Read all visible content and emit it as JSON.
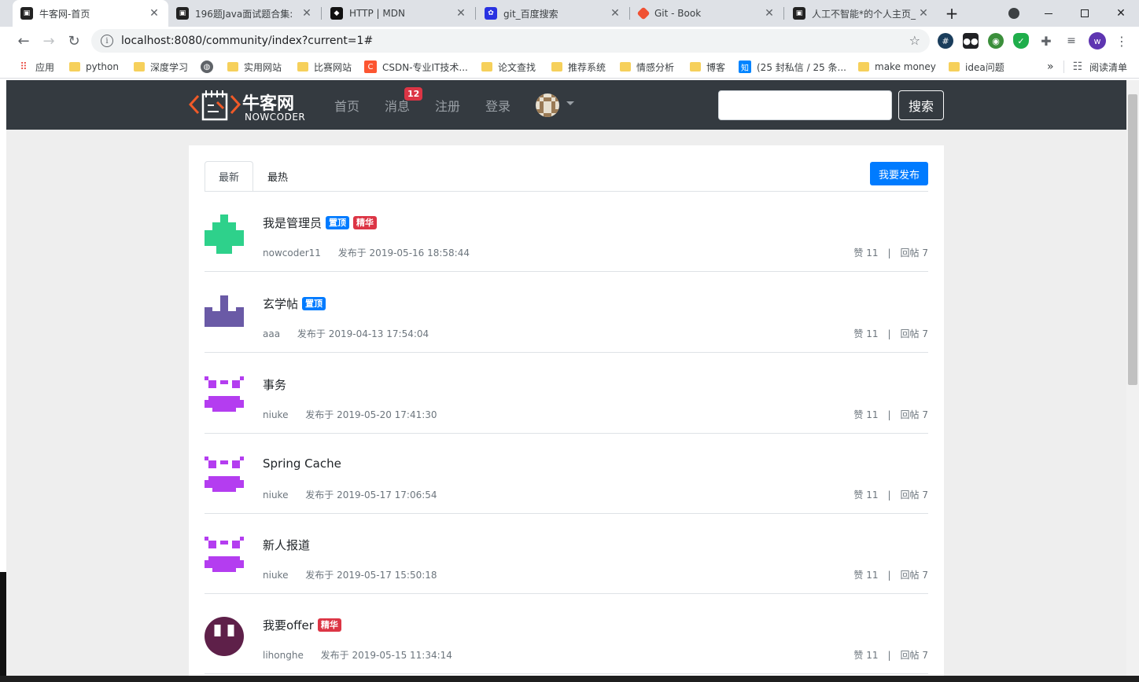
{
  "browser": {
    "tabs": [
      {
        "title": "牛客网-首页",
        "active": true
      },
      {
        "title": "196题Java面试题合集: ",
        "active": false
      },
      {
        "title": "HTTP | MDN",
        "active": false
      },
      {
        "title": "git_百度搜索",
        "active": false
      },
      {
        "title": "Git - Book",
        "active": false
      },
      {
        "title": "人工不智能*的个人主页_",
        "active": false
      }
    ],
    "new_tab": "+",
    "close_glyph": "✕",
    "url": "localhost:8080/community/index?current=1#",
    "profile_initial": "w",
    "bookmarks": [
      {
        "label": "应用",
        "icon": "apps-icon"
      },
      {
        "label": "python",
        "icon": "folder-icon"
      },
      {
        "label": "深度学习",
        "icon": "folder-icon"
      },
      {
        "label": "",
        "icon": "globe-icon"
      },
      {
        "label": "实用网站",
        "icon": "folder-icon"
      },
      {
        "label": "比赛网站",
        "icon": "folder-icon"
      },
      {
        "label": "CSDN-专业IT技术...",
        "icon": "csdn-icon"
      },
      {
        "label": "论文查找",
        "icon": "folder-icon"
      },
      {
        "label": "推荐系统",
        "icon": "folder-icon"
      },
      {
        "label": "情感分析",
        "icon": "folder-icon"
      },
      {
        "label": "博客",
        "icon": "folder-icon"
      },
      {
        "label": "(25 封私信 / 25 条...",
        "icon": "zhihu-icon"
      },
      {
        "label": "make money",
        "icon": "folder-icon"
      },
      {
        "label": "idea问题",
        "icon": "folder-icon"
      }
    ],
    "more_bookmarks": "»",
    "reading_list": "阅读清单",
    "colors": {
      "tab_strip": "#dee1e6",
      "folder": "#f6d05b"
    }
  },
  "site": {
    "brand": "牛客网",
    "brand_sub": "NOWCODER",
    "nav": {
      "home": "首页",
      "messages": "消息",
      "register": "注册",
      "login": "登录"
    },
    "message_count": "12",
    "search_placeholder": "",
    "search_button": "搜索",
    "colors": {
      "navbar": "#343a40",
      "primary": "#007bff",
      "danger": "#dc3545"
    }
  },
  "main": {
    "tabs": [
      {
        "label": "最新",
        "active": true
      },
      {
        "label": "最热",
        "active": false
      }
    ],
    "publish_button": "我要发布",
    "like_label": "赞 11",
    "reply_label": "回帖 7",
    "stats_separator": "|",
    "posts": [
      {
        "title": "我是管理员",
        "badges": [
          "置顶",
          "精华"
        ],
        "author": "nowcoder11",
        "time": "发布于 2019-05-16 18:58:44",
        "likes": "赞 11",
        "replies": "回帖 7",
        "avatar_color": "#2ed18b"
      },
      {
        "title": "玄学帖",
        "badges": [
          "置顶"
        ],
        "author": "aaa",
        "time": "发布于 2019-04-13 17:54:04",
        "likes": "赞 11",
        "replies": "回帖 7",
        "avatar_color": "#6a5aa6"
      },
      {
        "title": "事务",
        "badges": [],
        "author": "niuke",
        "time": "发布于 2019-05-20 17:41:30",
        "likes": "赞 11",
        "replies": "回帖 7",
        "avatar_color": "#b43df0"
      },
      {
        "title": "Spring Cache",
        "badges": [],
        "author": "niuke",
        "time": "发布于 2019-05-17 17:06:54",
        "likes": "赞 11",
        "replies": "回帖 7",
        "avatar_color": "#b43df0"
      },
      {
        "title": "新人报道",
        "badges": [],
        "author": "niuke",
        "time": "发布于 2019-05-17 15:50:18",
        "likes": "赞 11",
        "replies": "回帖 7",
        "avatar_color": "#b43df0"
      },
      {
        "title": "我要offer",
        "badges": [
          "精华"
        ],
        "author": "lihonghe",
        "time": "发布于 2019-05-15 11:34:14",
        "likes": "赞 11",
        "replies": "回帖 7",
        "avatar_color": "#5e2049"
      }
    ]
  }
}
